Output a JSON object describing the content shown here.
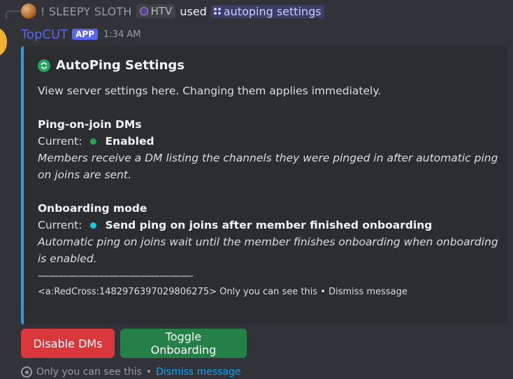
{
  "reply": {
    "username": "! SLEEPY SLOTH",
    "tag": "HTV",
    "used_text": "used",
    "command": "autoping settings"
  },
  "message": {
    "author": "TopCUT",
    "badge": "APP",
    "time": "1:34 AM"
  },
  "embed": {
    "accent_color": "#3498db",
    "title": "AutoPing Settings",
    "description": "View server settings here. Changing them applies immediately.",
    "fields": [
      {
        "name": "Ping-on-join DMs",
        "current_label": "Current:",
        "status_color": "#23a55a",
        "value": "Enabled",
        "description": "Members receive a DM listing the channels they were pinged in after automatic ping on joins are sent."
      },
      {
        "name": "Onboarding mode",
        "current_label": "Current:",
        "status_color": "#1fc6d6",
        "value": "Send ping on joins after member finished onboarding",
        "description": "Automatic ping on joins wait until the member finishes onboarding when onboarding is enabled."
      }
    ],
    "divider": "————————————————————",
    "footer": "<a:RedCross:1482976397029806275> Only you can see this • Dismiss message"
  },
  "buttons": {
    "disable_dms": "Disable DMs",
    "toggle_onboarding": "Toggle Onboarding"
  },
  "ephemeral": {
    "text": "Only you can see this",
    "separator": "•",
    "dismiss": "Dismiss message"
  }
}
